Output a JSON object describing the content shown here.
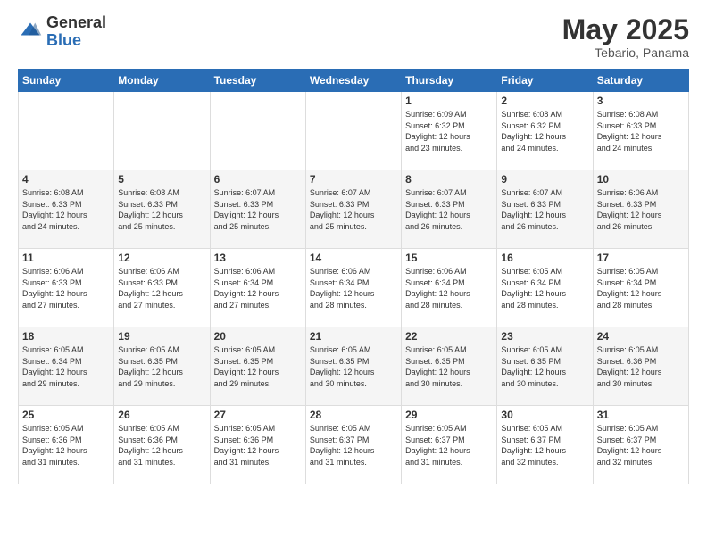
{
  "logo": {
    "general": "General",
    "blue": "Blue"
  },
  "title": "May 2025",
  "subtitle": "Tebario, Panama",
  "weekdays": [
    "Sunday",
    "Monday",
    "Tuesday",
    "Wednesday",
    "Thursday",
    "Friday",
    "Saturday"
  ],
  "weeks": [
    [
      {
        "day": "",
        "info": ""
      },
      {
        "day": "",
        "info": ""
      },
      {
        "day": "",
        "info": ""
      },
      {
        "day": "",
        "info": ""
      },
      {
        "day": "1",
        "info": "Sunrise: 6:09 AM\nSunset: 6:32 PM\nDaylight: 12 hours\nand 23 minutes."
      },
      {
        "day": "2",
        "info": "Sunrise: 6:08 AM\nSunset: 6:32 PM\nDaylight: 12 hours\nand 24 minutes."
      },
      {
        "day": "3",
        "info": "Sunrise: 6:08 AM\nSunset: 6:33 PM\nDaylight: 12 hours\nand 24 minutes."
      }
    ],
    [
      {
        "day": "4",
        "info": "Sunrise: 6:08 AM\nSunset: 6:33 PM\nDaylight: 12 hours\nand 24 minutes."
      },
      {
        "day": "5",
        "info": "Sunrise: 6:08 AM\nSunset: 6:33 PM\nDaylight: 12 hours\nand 25 minutes."
      },
      {
        "day": "6",
        "info": "Sunrise: 6:07 AM\nSunset: 6:33 PM\nDaylight: 12 hours\nand 25 minutes."
      },
      {
        "day": "7",
        "info": "Sunrise: 6:07 AM\nSunset: 6:33 PM\nDaylight: 12 hours\nand 25 minutes."
      },
      {
        "day": "8",
        "info": "Sunrise: 6:07 AM\nSunset: 6:33 PM\nDaylight: 12 hours\nand 26 minutes."
      },
      {
        "day": "9",
        "info": "Sunrise: 6:07 AM\nSunset: 6:33 PM\nDaylight: 12 hours\nand 26 minutes."
      },
      {
        "day": "10",
        "info": "Sunrise: 6:06 AM\nSunset: 6:33 PM\nDaylight: 12 hours\nand 26 minutes."
      }
    ],
    [
      {
        "day": "11",
        "info": "Sunrise: 6:06 AM\nSunset: 6:33 PM\nDaylight: 12 hours\nand 27 minutes."
      },
      {
        "day": "12",
        "info": "Sunrise: 6:06 AM\nSunset: 6:33 PM\nDaylight: 12 hours\nand 27 minutes."
      },
      {
        "day": "13",
        "info": "Sunrise: 6:06 AM\nSunset: 6:34 PM\nDaylight: 12 hours\nand 27 minutes."
      },
      {
        "day": "14",
        "info": "Sunrise: 6:06 AM\nSunset: 6:34 PM\nDaylight: 12 hours\nand 28 minutes."
      },
      {
        "day": "15",
        "info": "Sunrise: 6:06 AM\nSunset: 6:34 PM\nDaylight: 12 hours\nand 28 minutes."
      },
      {
        "day": "16",
        "info": "Sunrise: 6:05 AM\nSunset: 6:34 PM\nDaylight: 12 hours\nand 28 minutes."
      },
      {
        "day": "17",
        "info": "Sunrise: 6:05 AM\nSunset: 6:34 PM\nDaylight: 12 hours\nand 28 minutes."
      }
    ],
    [
      {
        "day": "18",
        "info": "Sunrise: 6:05 AM\nSunset: 6:34 PM\nDaylight: 12 hours\nand 29 minutes."
      },
      {
        "day": "19",
        "info": "Sunrise: 6:05 AM\nSunset: 6:35 PM\nDaylight: 12 hours\nand 29 minutes."
      },
      {
        "day": "20",
        "info": "Sunrise: 6:05 AM\nSunset: 6:35 PM\nDaylight: 12 hours\nand 29 minutes."
      },
      {
        "day": "21",
        "info": "Sunrise: 6:05 AM\nSunset: 6:35 PM\nDaylight: 12 hours\nand 30 minutes."
      },
      {
        "day": "22",
        "info": "Sunrise: 6:05 AM\nSunset: 6:35 PM\nDaylight: 12 hours\nand 30 minutes."
      },
      {
        "day": "23",
        "info": "Sunrise: 6:05 AM\nSunset: 6:35 PM\nDaylight: 12 hours\nand 30 minutes."
      },
      {
        "day": "24",
        "info": "Sunrise: 6:05 AM\nSunset: 6:36 PM\nDaylight: 12 hours\nand 30 minutes."
      }
    ],
    [
      {
        "day": "25",
        "info": "Sunrise: 6:05 AM\nSunset: 6:36 PM\nDaylight: 12 hours\nand 31 minutes."
      },
      {
        "day": "26",
        "info": "Sunrise: 6:05 AM\nSunset: 6:36 PM\nDaylight: 12 hours\nand 31 minutes."
      },
      {
        "day": "27",
        "info": "Sunrise: 6:05 AM\nSunset: 6:36 PM\nDaylight: 12 hours\nand 31 minutes."
      },
      {
        "day": "28",
        "info": "Sunrise: 6:05 AM\nSunset: 6:37 PM\nDaylight: 12 hours\nand 31 minutes."
      },
      {
        "day": "29",
        "info": "Sunrise: 6:05 AM\nSunset: 6:37 PM\nDaylight: 12 hours\nand 31 minutes."
      },
      {
        "day": "30",
        "info": "Sunrise: 6:05 AM\nSunset: 6:37 PM\nDaylight: 12 hours\nand 32 minutes."
      },
      {
        "day": "31",
        "info": "Sunrise: 6:05 AM\nSunset: 6:37 PM\nDaylight: 12 hours\nand 32 minutes."
      }
    ]
  ]
}
